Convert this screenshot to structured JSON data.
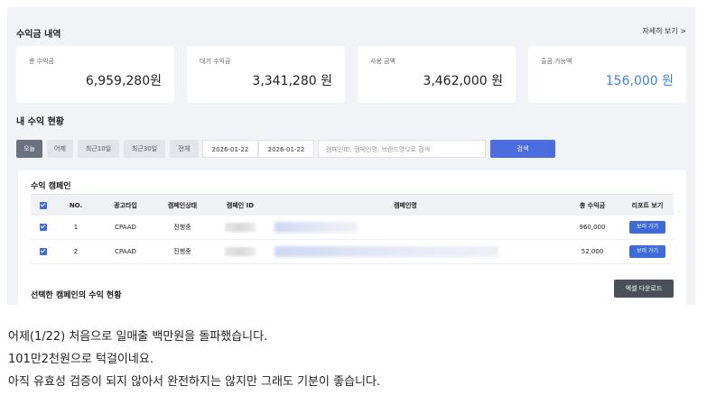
{
  "summary": {
    "title": "수익금 내역",
    "more_link": "자세히 보기 >",
    "cards": [
      {
        "label": "총 수익금",
        "value": "6,959,280원"
      },
      {
        "label": "대기 수익금",
        "value": "3,341,280 원"
      },
      {
        "label": "사용 금액",
        "value": "3,462,000 원"
      },
      {
        "label": "출금 가능액",
        "value": "156,000 원"
      }
    ],
    "accent_color": "#3f82e0"
  },
  "filters": {
    "title": "내 수익 현황",
    "buttons": [
      "오늘",
      "어제",
      "최근10일",
      "최근30일",
      "전체"
    ],
    "active_button": "오늘",
    "date_from": "2026-01-22",
    "date_to": "2026-01-22",
    "search_placeholder": "캠페인ID, 캠페인명, 브랜드명으로 검색",
    "search_button": "검색"
  },
  "table": {
    "title": "수익 캠페인",
    "columns": [
      "NO.",
      "광고타입",
      "캠페인상태",
      "캠페인 ID",
      "캠페인명",
      "총 수익금",
      "리포트 보기"
    ],
    "rows": [
      {
        "no": "1",
        "type": "CPAAD",
        "status": "진행중",
        "revenue": "960,000",
        "action": "보러 가기",
        "checked": true
      },
      {
        "no": "2",
        "type": "CPAAD",
        "status": "진행중",
        "revenue": "52,000",
        "action": "보러 가기",
        "checked": true
      }
    ]
  },
  "selected_section": {
    "title": "선택한 캠페인의 수익 현황",
    "excel_button": "엑셀 다운로드"
  },
  "post_text": [
    "어제(1/22) 처음으로 일매출 백만원을 돌파했습니다.",
    "101만2천원으로 턱걸이네요.",
    "아직 유효성 검증이 되지 않아서 완전하지는 않지만 그래도 기분이 좋습니다."
  ]
}
